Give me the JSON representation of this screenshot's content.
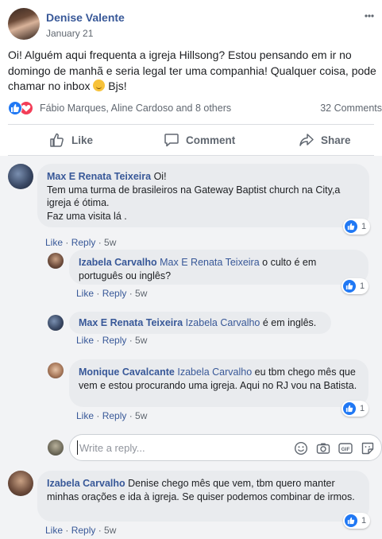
{
  "post": {
    "author": "Denise Valente",
    "date": "January 21",
    "text": "Oi! Alguém aqui frequenta a igreja Hillsong? Estou pensando em ir no domingo de manhã e seria legal ter uma companhia! Qualquer coisa, pode chamar no inbox ",
    "text_end": " Bjs!",
    "reactors": "Fábio Marques, Aline Cardoso and 8 others",
    "comment_count": "32 Comments"
  },
  "actions": {
    "like": "Like",
    "comment": "Comment",
    "share": "Share"
  },
  "comments": [
    {
      "author": "Max E Renata Teixeira",
      "text": "Oi! Tem uma turma de brasileiros na Gateway Baptist church na City,a igreja é ótima. Faz uma visita lá .",
      "line1": " Oi!",
      "line2": "Tem uma turma de brasileiros na Gateway Baptist church na City,a",
      "line3": "igreja é ótima.",
      "line4": "Faz uma visita lá .",
      "like": "Like",
      "reply": "Reply",
      "time": "5w",
      "likes": "1",
      "replies": [
        {
          "author": "Izabela Carvalho",
          "tag": "Max E Renata Teixeira",
          "text": " o culto é em português ou inglês?",
          "like": "Like",
          "reply": "Reply",
          "time": "5w",
          "likes": "1"
        },
        {
          "author": "Max E Renata Teixeira",
          "tag": "Izabela Carvalho",
          "text": " é em inglês.",
          "like": "Like",
          "reply": "Reply",
          "time": "5w"
        },
        {
          "author": "Monique Cavalcante",
          "tag": "Izabela Carvalho",
          "text": " eu tbm chego mês que vem e estou procurando uma igreja. Aqui no RJ vou na Batista.",
          "like": "Like",
          "reply": "Reply",
          "time": "5w",
          "likes": "1"
        }
      ]
    },
    {
      "author": "Izabela Carvalho",
      "text": " Denise chego mês que vem, tbm quero manter minhas orações e ida à igreja. Se quiser podemos combinar de irmos.",
      "like": "Like",
      "reply": "Reply",
      "time": "5w",
      "likes": "1"
    }
  ],
  "reply_box": {
    "placeholder": "Write a reply..."
  },
  "icons": [
    "like-thumb-icon",
    "love-heart-icon",
    "comment-bubble-icon",
    "share-arrow-icon",
    "emoji-icon",
    "camera-icon",
    "gif-icon",
    "sticker-icon",
    "more-icon"
  ],
  "colors": {
    "link": "#385898",
    "like_blue": "#2078f4",
    "love_red": "#f33e58",
    "bubble_bg": "#e9ebee",
    "comments_bg": "#f2f3f5"
  }
}
